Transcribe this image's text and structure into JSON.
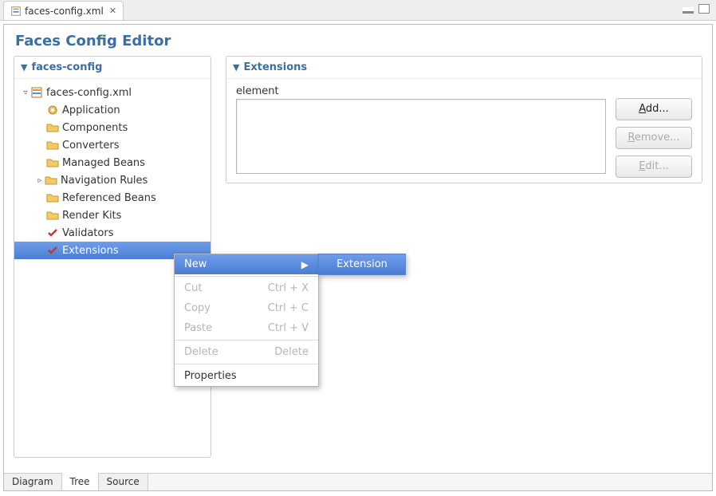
{
  "tab": {
    "title": "faces-config.xml",
    "close_glyph": "✕"
  },
  "editor_title": "Faces Config Editor",
  "left_panel": {
    "title": "faces-config"
  },
  "tree": {
    "root": {
      "label": "faces-config.xml"
    },
    "items": [
      {
        "label": "Application"
      },
      {
        "label": "Components"
      },
      {
        "label": "Converters"
      },
      {
        "label": "Managed Beans"
      },
      {
        "label": "Navigation Rules",
        "has_children": true
      },
      {
        "label": "Referenced Beans"
      },
      {
        "label": "Render Kits"
      },
      {
        "label": "Validators"
      },
      {
        "label": "Extensions",
        "selected": true
      }
    ]
  },
  "right_panel": {
    "title": "Extensions",
    "element_label": "element",
    "buttons": {
      "add": {
        "ul": "A",
        "rest": "dd..."
      },
      "remove": {
        "ul": "R",
        "rest": "emove..."
      },
      "edit": {
        "ul": "E",
        "rest": "dit..."
      }
    }
  },
  "context_menu": {
    "new": "New",
    "cut": "Cut",
    "cut_accel": "Ctrl + X",
    "copy": "Copy",
    "copy_accel": "Ctrl + C",
    "paste": "Paste",
    "paste_accel": "Ctrl + V",
    "delete": "Delete",
    "delete_accel": "Delete",
    "properties": "Properties",
    "submenu_extension": "Extension"
  },
  "bottom_tabs": {
    "diagram": "Diagram",
    "tree": "Tree",
    "source": "Source"
  }
}
